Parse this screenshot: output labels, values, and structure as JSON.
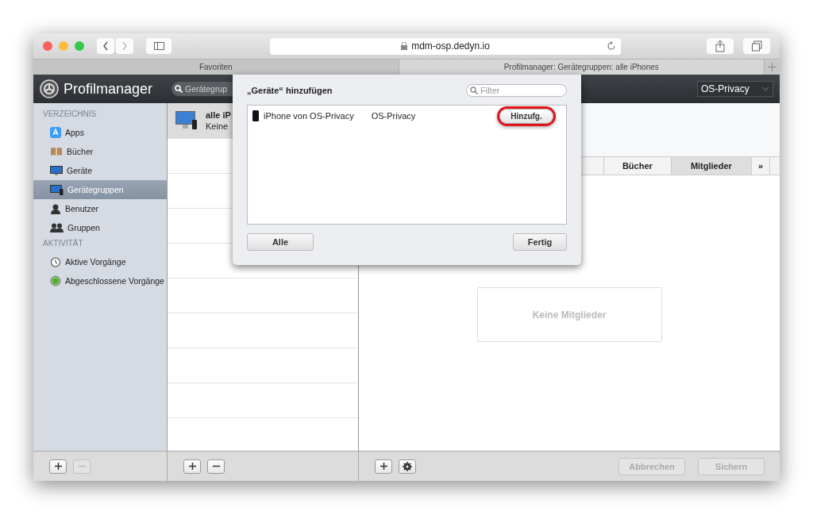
{
  "browser": {
    "url": "mdm-osp.dedyn.io",
    "tabs": [
      {
        "label": "Favoriten",
        "selected": false
      },
      {
        "label": "Profilmanager: Gerätegruppen: alle iPhones",
        "selected": true
      }
    ]
  },
  "app": {
    "title": "Profilmanager",
    "search": {
      "placeholder": "Gerätegrup"
    },
    "org_select": "OS-Privacy"
  },
  "sidebar": {
    "sections": [
      {
        "title": "VERZEICHNIS",
        "items": [
          {
            "label": "Apps",
            "selected": false
          },
          {
            "label": "Bücher",
            "selected": false
          },
          {
            "label": "Geräte",
            "selected": false
          },
          {
            "label": "Gerätegruppen",
            "selected": true
          },
          {
            "label": "Benutzer",
            "selected": false
          },
          {
            "label": "Gruppen",
            "selected": false
          }
        ]
      },
      {
        "title": "AKTIVITÄT",
        "items": [
          {
            "label": "Aktive Vorgänge",
            "selected": false
          },
          {
            "label": "Abgeschlossene Vorgänge",
            "selected": false
          }
        ]
      }
    ]
  },
  "group_list": {
    "rows": [
      {
        "title": "alle iP",
        "subtitle": "Keine",
        "selected": true
      }
    ]
  },
  "detail": {
    "tabs": [
      {
        "label": "Bücher",
        "selected": false
      },
      {
        "label": "Mitglieder",
        "selected": true
      },
      {
        "label": "»",
        "selected": false
      }
    ],
    "empty_message": "Keine Mitglieder"
  },
  "footer": {
    "sidebar_buttons": [
      {
        "kind": "add",
        "disabled": false
      },
      {
        "kind": "remove",
        "disabled": true
      }
    ],
    "list_buttons": [
      {
        "kind": "add",
        "disabled": false
      },
      {
        "kind": "remove",
        "disabled": false
      }
    ],
    "detail_buttons": [
      {
        "kind": "add",
        "disabled": false
      },
      {
        "kind": "gear",
        "disabled": false
      }
    ],
    "actions": [
      {
        "label": "Abbrechen",
        "disabled": true
      },
      {
        "label": "Sichern",
        "disabled": true
      }
    ]
  },
  "dialog": {
    "title": "„Geräte“ hinzufügen",
    "filter": {
      "placeholder": "Filter"
    },
    "rows": [
      {
        "name": "iPhone von OS-Privacy",
        "owner": "OS-Privacy",
        "button": "Hinzufg.",
        "highlighted": true
      }
    ],
    "buttons": [
      "Alle",
      "Fertig"
    ]
  }
}
